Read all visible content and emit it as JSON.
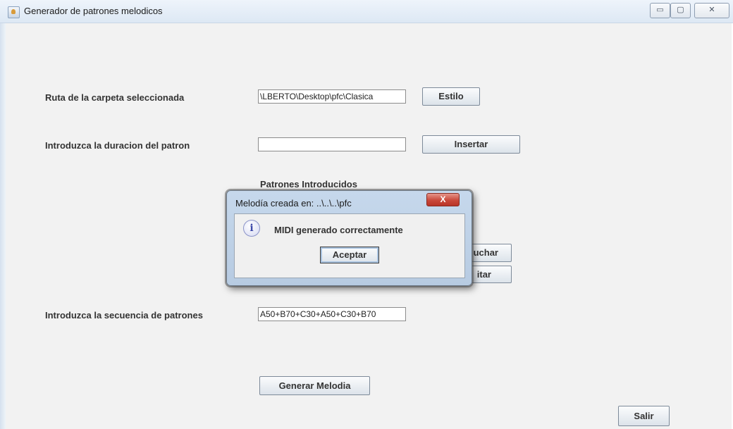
{
  "window": {
    "title": "Generador de patrones melodicos",
    "controls": {
      "minimize": "▭",
      "maximize": "▢",
      "close": "✕"
    }
  },
  "form": {
    "folder_label": "Ruta de la carpeta seleccionada",
    "folder_value": "\\LBERTO\\Desktop\\pfc\\Clasica",
    "style_button": "Estilo",
    "duration_label": "Introduzca la duracion del patron",
    "duration_value": "",
    "insert_button": "Insertar",
    "patterns_label": "Patrones Introducidos",
    "listen_button_partial": "uchar",
    "edit_button_partial": "itar",
    "sequence_label": "Introduzca la secuencia de patrones",
    "sequence_value": "A50+B70+C30+A50+C30+B70",
    "generate_button": "Generar Melodia",
    "exit_button": "Salir"
  },
  "dialog": {
    "title": "Melodía creada en: ..\\..\\..\\pfc",
    "close_glyph": "X",
    "icon": "info-icon",
    "icon_glyph": "i",
    "message": "MIDI generado correctamente",
    "ok_button": "Aceptar"
  }
}
